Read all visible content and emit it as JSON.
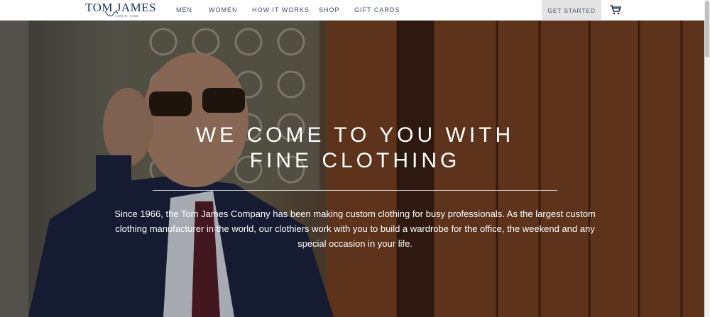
{
  "brand": {
    "name": "TOM JAMES",
    "tagline": "SINCE 1966"
  },
  "nav": {
    "items": [
      "MEN",
      "WOMEN",
      "HOW IT WORKS",
      "SHOP",
      "GIFT CARDS"
    ],
    "cta_label": "GET STARTED",
    "cart_icon": "cart-icon"
  },
  "hero": {
    "headline_line1": "WE COME TO YOU WITH",
    "headline_line2": "FINE CLOTHING",
    "body": "Since 1966, the Tom James Company has been making custom clothing for busy professionals. As the largest custom clothing manufacturer in the world, our clothiers work with you to build a wardrobe for the office, the weekend and any special occasion in your life."
  },
  "colors": {
    "brand_navy": "#1f2f52",
    "nav_text": "#3d4a66",
    "cta_bg": "#e4e4e4",
    "hero_text": "#ffffff"
  }
}
